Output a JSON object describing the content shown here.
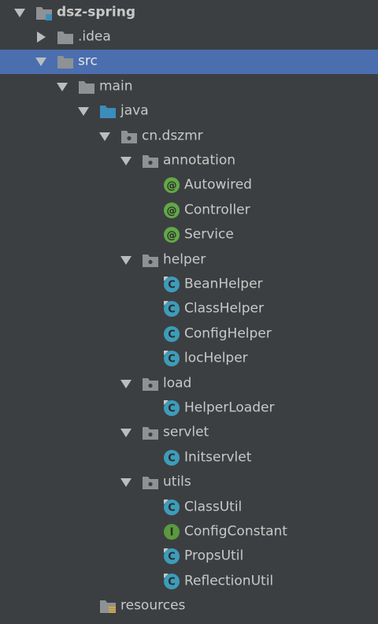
{
  "project_tree": {
    "root": {
      "label": "dsz-spring"
    },
    "idea": {
      "label": ".idea"
    },
    "src": {
      "label": "src"
    },
    "main": {
      "label": "main"
    },
    "java": {
      "label": "java"
    },
    "package_root": {
      "label": "cn.dszmr"
    },
    "annotation": {
      "label": "annotation",
      "items": [
        "Autowired",
        "Controller",
        "Service"
      ]
    },
    "helper": {
      "label": "helper",
      "items": [
        "BeanHelper",
        "ClassHelper",
        "ConfigHelper",
        "locHelper"
      ]
    },
    "load": {
      "label": "load",
      "items": [
        "HelperLoader"
      ]
    },
    "servlet": {
      "label": "servlet",
      "items": [
        "Initservlet"
      ]
    },
    "utils": {
      "label": "utils",
      "items": [
        "ClassUtil",
        "ConfigConstant",
        "PropsUtil",
        "ReflectionUtil"
      ]
    },
    "resources": {
      "label": "resources"
    }
  },
  "colors": {
    "background": "#3c3f41",
    "selection": "#4b6eaf",
    "folder": "#8e9294",
    "source_folder": "#3c8dbc",
    "class_icon": "#3d9cb9",
    "annotation_icon": "#62a847",
    "interface_icon": "#5a9a3e"
  }
}
